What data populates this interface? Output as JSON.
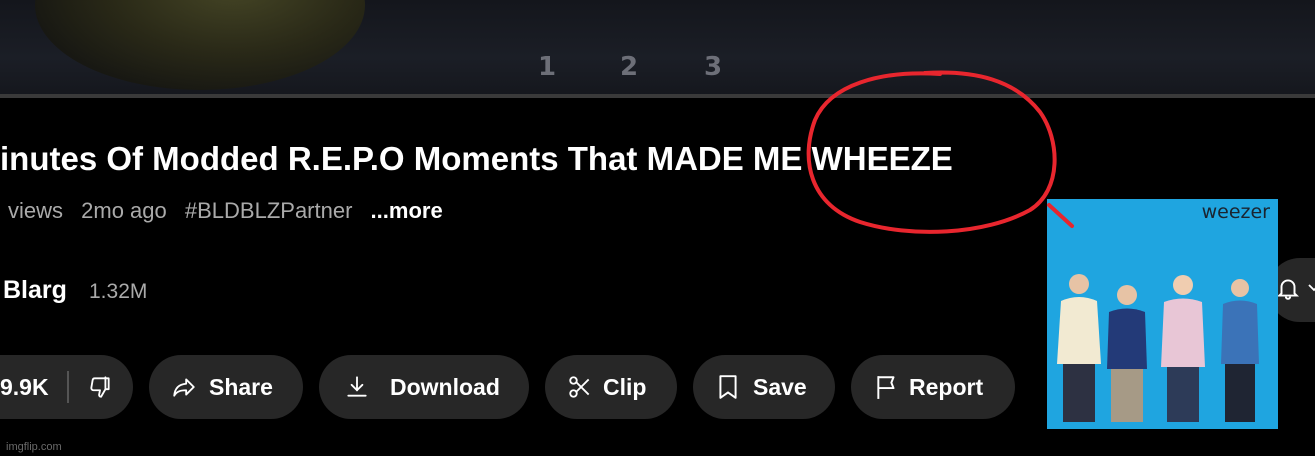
{
  "video": {
    "overlay_numbers": [
      "1",
      "2",
      "3"
    ]
  },
  "title": "inutes Of Modded R.E.P.O Moments That MADE ME WHEEZE",
  "meta": {
    "views": "views",
    "age": "2mo ago",
    "hashtag": "#BLDBLZPartner",
    "more": "...more"
  },
  "channel": {
    "name": "Blarg",
    "subscribers": "1.32M"
  },
  "actions": {
    "like_count": "9.9K",
    "share": "Share",
    "download": "Download",
    "clip": "Clip",
    "save": "Save",
    "report": "Report"
  },
  "album": {
    "brand": "weezer"
  },
  "watermark": "imgflip.com",
  "colors": {
    "background": "#000000",
    "pill": "#272727",
    "annotation": "#e8262e",
    "album_blue": "#1fa5e0"
  }
}
